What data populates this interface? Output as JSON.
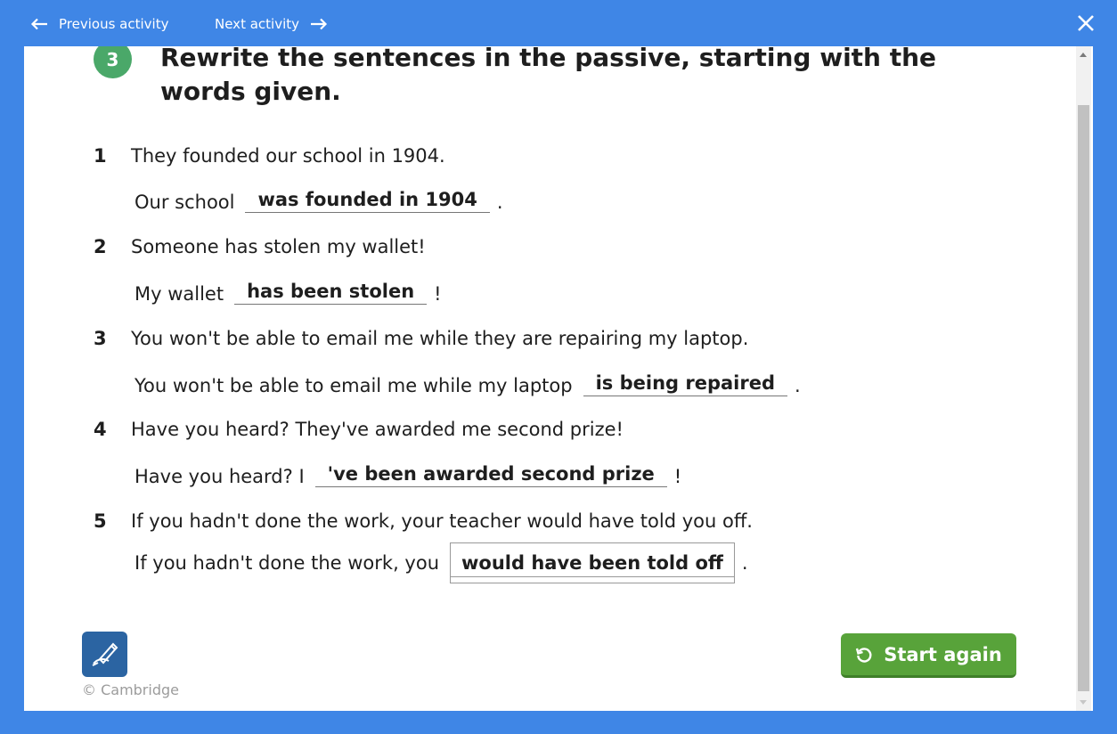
{
  "nav": {
    "previous_label": "Previous activity",
    "next_label": "Next activity"
  },
  "exercise": {
    "number": "3",
    "instruction": "Rewrite the sentences in the passive, starting with the words given."
  },
  "questions": [
    {
      "num": "1",
      "sentence": "They founded our school in 1904.",
      "prefix": "Our school",
      "answer": "was founded in 1904",
      "suffix": "."
    },
    {
      "num": "2",
      "sentence": "Someone has stolen my wallet!",
      "prefix": "My wallet",
      "answer": "has been stolen",
      "suffix": "!"
    },
    {
      "num": "3",
      "sentence": "You won't be able to email me while they are repairing my laptop.",
      "prefix": "You won't be able to email me while my laptop",
      "answer": "is being repaired",
      "suffix": "."
    },
    {
      "num": "4",
      "sentence": "Have you heard? They've awarded me second prize!",
      "prefix": "Have you heard? I",
      "answer": "'ve been awarded second prize",
      "suffix": "!"
    },
    {
      "num": "5",
      "sentence": "If you hadn't done the work, your teacher would have told you off.",
      "prefix": "If you hadn't done the work, you",
      "answer": "would have been told off",
      "suffix": "."
    }
  ],
  "footer": {
    "copyright": "© Cambridge",
    "start_again_label": "Start again"
  },
  "colors": {
    "frame": "#3f86e6",
    "badge": "#4aa869",
    "start_button": "#58a33a",
    "pen_button": "#2b64a2"
  },
  "icons": [
    "arrow-left-icon",
    "arrow-right-icon",
    "close-icon",
    "pen-annotate-icon",
    "restart-icon"
  ]
}
